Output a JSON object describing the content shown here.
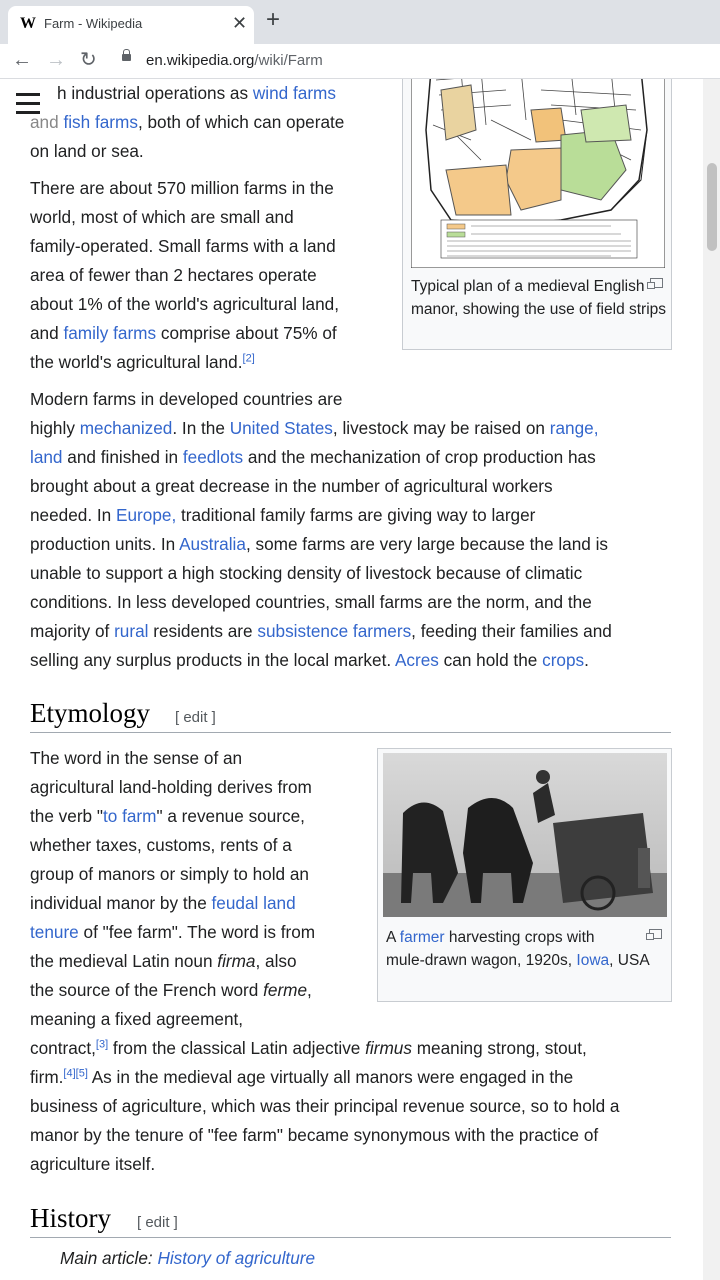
{
  "browser": {
    "tab_title": "Farm - Wikipedia",
    "favicon": "W",
    "close_glyph": "✕",
    "new_tab_glyph": "+",
    "back_glyph": "←",
    "forward_glyph": "→",
    "reload_glyph": "↻",
    "url_host": "en.wikipedia.org",
    "url_path": "/wiki/Farm"
  },
  "article": {
    "p1": {
      "t1": "h industrial operations as ",
      "link1": "wind farms",
      "t2": "and ",
      "link2": "fish farms",
      "t3": ", both of which can operate",
      "t4": "on land or sea."
    },
    "p2": {
      "l1": "There are about 570 million farms in the",
      "l2": "world, most of which are small and",
      "l3": "family-operated. Small farms with a land",
      "l4": "area of fewer than 2 hectares operate",
      "l5": "about 1% of the world's agricultural land,",
      "l6a": "and ",
      "l6link": "family farms",
      "l6b": " comprise about 75% of",
      "l7": "the world's agricultural land.",
      "ref": "[2]"
    },
    "figure1_caption": "Typical plan of a medieval English manor, showing the use of field strips",
    "p3": {
      "l1": "Modern farms in developed countries are",
      "l2a": "highly ",
      "l2link1": "mechanized",
      "l2b": ". In the ",
      "l2link2": "United States",
      "l2c": ", livestock may be raised on ",
      "l2link3": "range,",
      "l3link": "land",
      "l3a": " and finished in ",
      "l3link2": "feedlots",
      "l3b": " and the mechanization of crop production has",
      "l4": "brought about a great decrease in the number of agricultural workers",
      "l5a": "needed. In ",
      "l5link": "Europe,",
      "l5b": " traditional family farms are giving way to larger",
      "l6a": "production units. In ",
      "l6link": "Australia",
      "l6b": ", some farms are very large because the land is",
      "l7": "unable to support a high stocking density of livestock because of climatic",
      "l8": "conditions. In less developed countries, small farms are the norm, and the",
      "l9a": "majority of ",
      "l9link1": "rural",
      "l9b": " residents are ",
      "l9link2": "subsistence farmers",
      "l9c": ", feeding their families and",
      "l10a": "selling any surplus products in the local market. ",
      "l10link1": "Acres",
      "l10b": " can hold the ",
      "l10link2": "crops",
      "l10c": "."
    },
    "etymology": {
      "heading": "Etymology",
      "edit": "[ edit ]",
      "l1": "The word in the sense of an",
      "l2": "agricultural land-holding derives from",
      "l3a": "the verb \"",
      "l3link": "to farm",
      "l3b": "\" a revenue source,",
      "l4": "whether taxes, customs, rents of a",
      "l5": "group of manors or simply to hold an",
      "l6": "individual manor by the ",
      "l6link": "feudal land",
      "l7link": "tenure",
      "l7": " of \"fee farm\". The word is from",
      "l8a": "the medieval Latin noun ",
      "l8em": "firma",
      "l8b": ", also",
      "l9a": "the source of the French word ",
      "l9em": "ferme",
      "l9b": ",",
      "l10": "meaning a fixed agreement,",
      "l11a": "contract,",
      "ref3": "[3]",
      "l11b": " from the classical Latin adjective ",
      "l11em": "firmus",
      "l11c": " meaning strong, stout,",
      "l12a": "firm.",
      "ref45": "[4][5]",
      "l12b": " As in the medieval age virtually all manors were engaged in the",
      "l13": "business of agriculture, which was their principal revenue source, so to hold a",
      "l14": "manor by the tenure of \"fee farm\" became synonymous with the practice of",
      "l15": "agriculture itself."
    },
    "figure2": {
      "cap_a": "A ",
      "cap_link1": "farmer",
      "cap_b": " harvesting crops with",
      "cap_c": "mule-drawn wagon, 1920s, ",
      "cap_link2": "Iowa",
      "cap_d": ", USA"
    },
    "history": {
      "heading": "History",
      "edit": "[ edit ]",
      "main_label": "Main article: ",
      "main_link": "History of agriculture"
    }
  },
  "colors": {
    "link": "#3366cc",
    "text": "#202122",
    "rule": "#a2a9b1"
  }
}
